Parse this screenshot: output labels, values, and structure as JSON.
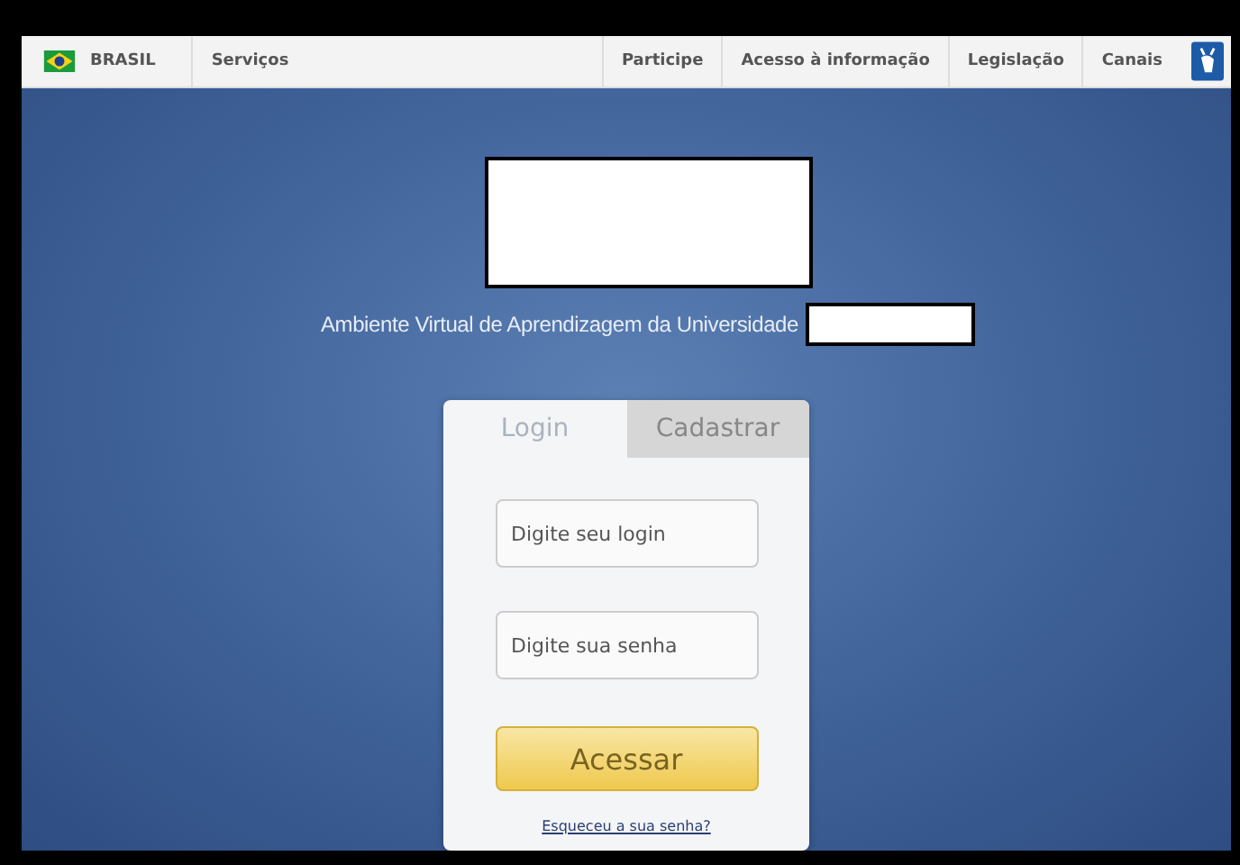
{
  "gov_bar": {
    "brand": "BRASIL",
    "left_links": [
      "Serviços"
    ],
    "right_links": [
      "Participe",
      "Acesso à informação",
      "Legislação",
      "Canais"
    ]
  },
  "subtitle": "Ambiente Virtual de Aprendizagem da Universidade",
  "tabs": [
    {
      "label": "Login",
      "selected": true
    },
    {
      "label": "Cadastrar",
      "selected": false
    }
  ],
  "fields": [
    {
      "placeholder": "Digite seu login"
    },
    {
      "placeholder": "Digite sua senha"
    }
  ],
  "submit": "Acessar",
  "forgot_link": "Esqueceu a sua senha?"
}
